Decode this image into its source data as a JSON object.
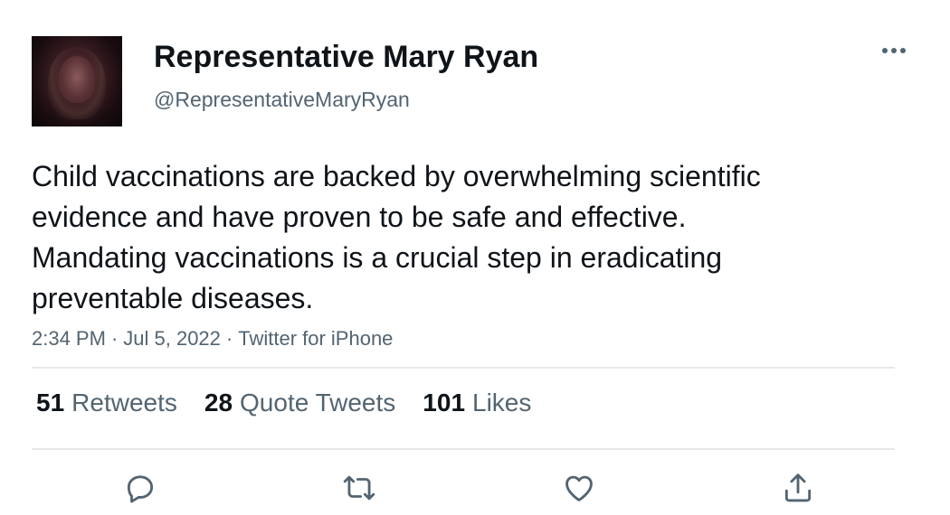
{
  "tweet": {
    "author": {
      "display_name": "Representative Mary Ryan",
      "handle": "@RepresentativeMaryRyan"
    },
    "text": "Child vaccinations are backed by overwhelming scientific evidence and have proven to be safe and effective. Mandating vaccinations is a crucial step in eradicating preventable diseases.",
    "time": "2:34 PM",
    "date": "Jul 5, 2022",
    "source": "Twitter for iPhone",
    "separator": "·",
    "stats": {
      "retweets": {
        "count": "51",
        "label": "Retweets"
      },
      "quotes": {
        "count": "28",
        "label": "Quote Tweets"
      },
      "likes": {
        "count": "101",
        "label": "Likes"
      }
    }
  },
  "icons": {
    "more": "more-horizontal-icon",
    "reply": "reply-icon",
    "retweet": "retweet-icon",
    "like": "like-icon",
    "share": "share-icon"
  },
  "colors": {
    "text_primary": "#0f1419",
    "text_secondary": "#536471",
    "divider": "#e6e9eb"
  }
}
